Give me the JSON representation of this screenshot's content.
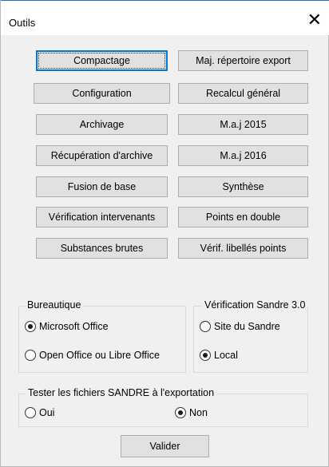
{
  "window": {
    "title": "Outils",
    "close_glyph": "✕"
  },
  "tools": {
    "left": [
      "Compactage",
      "Configuration",
      "Archivage",
      "Récupération d'archive",
      "Fusion de base",
      "Vérification intervenants",
      "Substances brutes"
    ],
    "right": [
      "Maj. répertoire export",
      "Recalcul général",
      "M.a.j 2015",
      "M.a.j 2016",
      "Synthèse",
      "Points en double",
      "Vérif. libellés points"
    ]
  },
  "bureautique": {
    "legend": "Bureautique",
    "options": [
      {
        "label": "Microsoft Office",
        "selected": true
      },
      {
        "label": "Open Office ou Libre Office",
        "selected": false
      }
    ]
  },
  "sandre_version": {
    "legend": "Vérification Sandre 3.0",
    "options": [
      {
        "label": "Site du Sandre",
        "selected": false
      },
      {
        "label": "Local",
        "selected": true
      }
    ]
  },
  "export_test": {
    "legend": "Tester les fichiers SANDRE à l'exportation",
    "options": [
      {
        "label": "Oui",
        "selected": false
      },
      {
        "label": "Non",
        "selected": true
      }
    ]
  },
  "validate_label": "Valider"
}
